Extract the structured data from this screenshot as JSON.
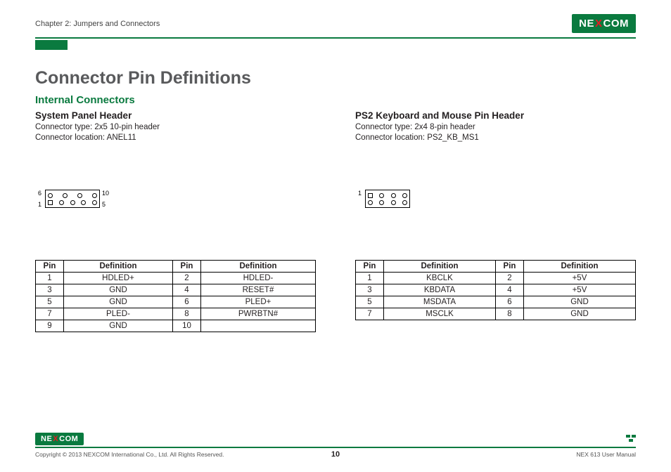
{
  "header": {
    "chapter": "Chapter 2: Jumpers and Connectors",
    "logo_text_pre": "NE",
    "logo_text_x": "X",
    "logo_text_post": "COM"
  },
  "title": "Connector Pin Definitions",
  "subtitle": "Internal Connectors",
  "left": {
    "heading": "System Panel Header",
    "type": "Connector type: 2x5 10-pin header",
    "location": "Connector location: ANEL11",
    "diag_labels": {
      "tl": "6",
      "tr": "10",
      "bl": "1",
      "br": "5"
    },
    "table_headers": [
      "Pin",
      "Definition",
      "Pin",
      "Definition"
    ],
    "rows": [
      [
        "1",
        "HDLED+",
        "2",
        "HDLED-"
      ],
      [
        "3",
        "GND",
        "4",
        "RESET#"
      ],
      [
        "5",
        "GND",
        "6",
        "PLED+"
      ],
      [
        "7",
        "PLED-",
        "8",
        "PWRBTN#"
      ],
      [
        "9",
        "GND",
        "10",
        ""
      ]
    ]
  },
  "right": {
    "heading": "PS2 Keyboard and Mouse Pin Header",
    "type": "Connector type: 2x4 8-pin header",
    "location": "Connector location: PS2_KB_MS1",
    "diag_labels": {
      "l": "1"
    },
    "table_headers": [
      "Pin",
      "Definition",
      "Pin",
      "Definition"
    ],
    "rows": [
      [
        "1",
        "KBCLK",
        "2",
        "+5V"
      ],
      [
        "3",
        "KBDATA",
        "4",
        "+5V"
      ],
      [
        "5",
        "MSDATA",
        "6",
        "GND"
      ],
      [
        "7",
        "MSCLK",
        "8",
        "GND"
      ]
    ]
  },
  "footer": {
    "copyright": "Copyright © 2013 NEXCOM International Co., Ltd. All Rights Reserved.",
    "page": "10",
    "manual": "NEX 613 User Manual"
  }
}
